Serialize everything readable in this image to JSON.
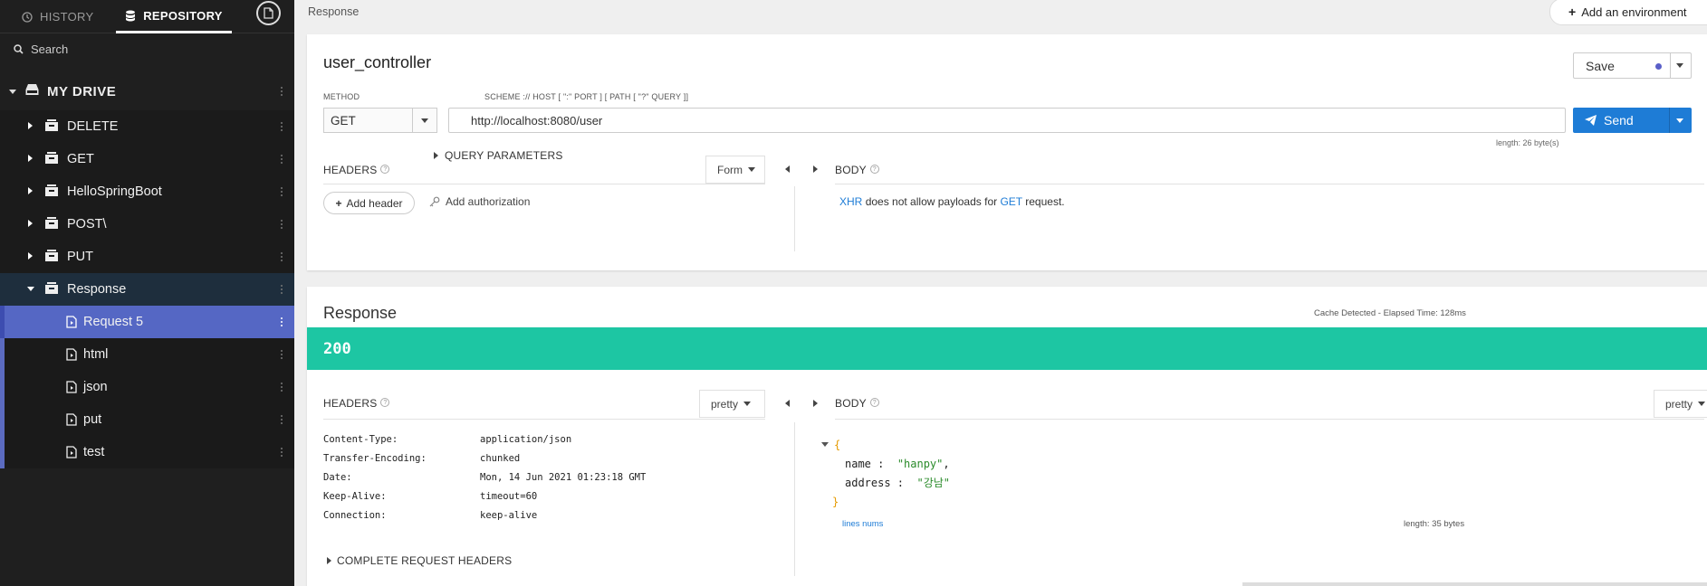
{
  "sidebar": {
    "tabs": {
      "history": "HISTORY",
      "repository": "REPOSITORY"
    },
    "search_placeholder": "Search",
    "drive_label": "MY DRIVE",
    "folders": [
      {
        "label": "DELETE"
      },
      {
        "label": "GET"
      },
      {
        "label": "HelloSpringBoot"
      },
      {
        "label": "POST\\"
      },
      {
        "label": "PUT"
      },
      {
        "label": "Response"
      }
    ],
    "requests": [
      {
        "label": "Request 5"
      },
      {
        "label": "html"
      },
      {
        "label": "json"
      },
      {
        "label": "put"
      },
      {
        "label": "test"
      }
    ]
  },
  "topbar": {
    "breadcrumb": "Response",
    "add_env_label": "Add an environment"
  },
  "request": {
    "title": "user_controller",
    "save_label": "Save",
    "method_label": "METHOD",
    "scheme_label": "SCHEME :// HOST [ \":\" PORT ] [ PATH [ \"?\" QUERY ]]",
    "method_value": "GET",
    "url_value": "http://localhost:8080/user",
    "send_label": "Send",
    "url_length": "length: 26 byte(s)",
    "query_params_label": "QUERY PARAMETERS",
    "headers_label": "HEADERS",
    "headers_mode": "Form",
    "add_header_label": "Add header",
    "add_auth_label": "Add authorization",
    "body_label": "BODY",
    "body_note": {
      "xhr": "XHR",
      "middle": "does not allow payloads for",
      "method": "GET",
      "end": "request."
    }
  },
  "response": {
    "title": "Response",
    "meta": "Cache Detected - Elapsed Time: 128ms",
    "status": "200",
    "headers_label": "HEADERS",
    "headers_mode": "pretty",
    "body_label": "BODY",
    "body_mode": "pretty",
    "headers": [
      {
        "key": "Content-Type:",
        "value": "application/json"
      },
      {
        "key": "Transfer-Encoding:",
        "value": "chunked"
      },
      {
        "key": "Date:",
        "value": "Mon, 14 Jun 2021 01:23:18 GMT"
      },
      {
        "key": "Keep-Alive:",
        "value": "timeout=60"
      },
      {
        "key": "Connection:",
        "value": "keep-alive"
      }
    ],
    "complete_headers_label": "COMPLETE REQUEST HEADERS",
    "json": {
      "open": "{",
      "close": "}",
      "fields": [
        {
          "key": "name",
          "value": "\"hanpy\"",
          "comma": ","
        },
        {
          "key": "address",
          "value": "\"강남\"",
          "comma": ""
        }
      ]
    },
    "lines_nums_label": "lines nums",
    "body_length": "length: 35 bytes"
  },
  "colors": {
    "accent_blue": "#1e7cd6",
    "status_ok": "#1dc6a3",
    "active_item": "#5567c4",
    "sidebar_bg": "#1f1f1f"
  },
  "icons": {
    "history": "history-icon",
    "repository": "database-icon",
    "new_file": "new-file-icon",
    "search": "search-icon",
    "folder": "collection-icon",
    "request": "request-file-icon",
    "send": "paper-plane-icon",
    "add": "plus-icon",
    "auth": "key-icon"
  }
}
